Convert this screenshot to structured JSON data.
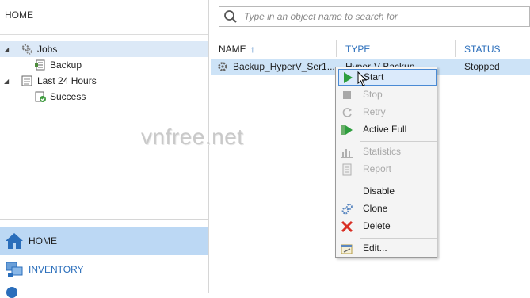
{
  "left_pane": {
    "title": "HOME",
    "tree": [
      {
        "label": "Jobs",
        "icon": "jobs-gear-icon",
        "selected": true
      },
      {
        "label": "Backup",
        "icon": "backup-icon"
      },
      {
        "label": "Last 24 Hours",
        "icon": "recent-icon"
      },
      {
        "label": "Success",
        "icon": "success-icon"
      }
    ],
    "nav": [
      {
        "label": "HOME",
        "icon": "home-icon",
        "active": true
      },
      {
        "label": "INVENTORY",
        "icon": "inventory-icon"
      }
    ]
  },
  "search": {
    "placeholder": "Type in an object name to search for"
  },
  "table": {
    "columns": [
      "NAME",
      "TYPE",
      "STATUS"
    ],
    "sort_indicator": "↑",
    "rows": [
      {
        "name": "Backup_HyperV_Ser1...",
        "type": "Hyper-V Backup",
        "status": "Stopped"
      }
    ]
  },
  "context_menu": {
    "items": [
      {
        "label": "Start",
        "icon": "play-icon",
        "enabled": true,
        "highlighted": true
      },
      {
        "label": "Stop",
        "icon": "stop-icon",
        "enabled": false
      },
      {
        "label": "Retry",
        "icon": "retry-icon",
        "enabled": false
      },
      {
        "label": "Active Full",
        "icon": "active-full-icon",
        "enabled": true
      },
      {
        "label": "Statistics",
        "icon": "statistics-icon",
        "enabled": false
      },
      {
        "label": "Report",
        "icon": "report-icon",
        "enabled": false
      },
      {
        "label": "Disable",
        "icon": "",
        "enabled": true
      },
      {
        "label": "Clone",
        "icon": "clone-icon",
        "enabled": true
      },
      {
        "label": "Delete",
        "icon": "delete-icon",
        "enabled": true
      },
      {
        "label": "Edit...",
        "icon": "edit-icon",
        "enabled": true
      }
    ]
  },
  "watermark": "vnfree.net",
  "colors": {
    "selection": "#cde3f7",
    "nav_active": "#bcd8f4",
    "accent": "#2a6ebb",
    "play_green": "#2e9e3e",
    "delete_red": "#d93025"
  }
}
